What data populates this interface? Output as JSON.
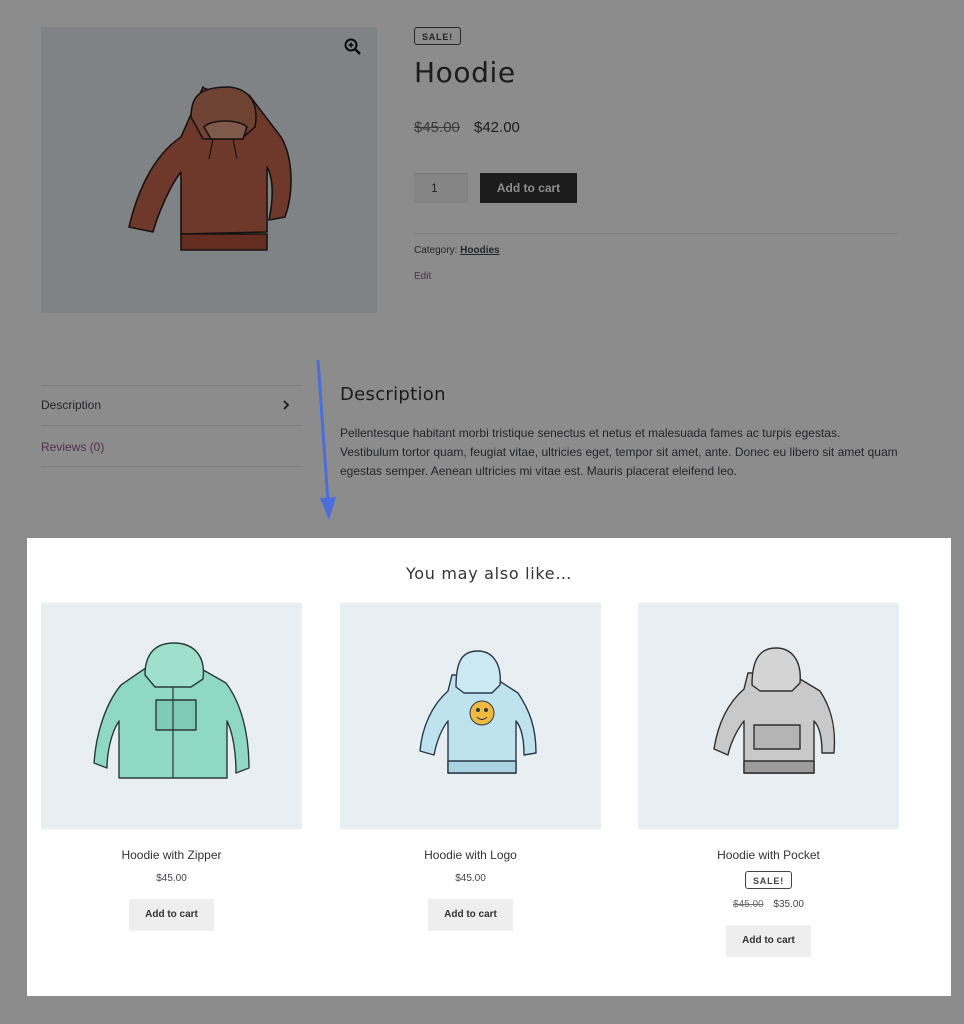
{
  "product": {
    "sale_badge": "SALE!",
    "title": "Hoodie",
    "old_price": "$45.00",
    "price": "$42.00",
    "quantity": "1",
    "add_to_cart": "Add to cart",
    "category_label": "Category:",
    "category_value": "Hoodies",
    "edit_link": "Edit",
    "image_icon": "hoodie-red-image",
    "zoom_icon": "zoom-in-icon"
  },
  "tabs": [
    {
      "label": "Description",
      "active": true
    },
    {
      "label": "Reviews (0)",
      "active": false
    }
  ],
  "description": {
    "heading": "Description",
    "text": "Pellentesque habitant morbi tristique senectus et netus et malesuada fames ac turpis egestas. Vestibulum tortor quam, feugiat vitae, ultricies eget, tempor sit amet, ante. Donec eu libero sit amet quam egestas semper. Aenean ultricies mi vitae est. Mauris placerat eleifend leo."
  },
  "related": {
    "title": "You may also like…",
    "products": [
      {
        "name": "Hoodie with Zipper",
        "price": "$45.00",
        "button": "Add to cart",
        "color": "#8fd8c4"
      },
      {
        "name": "Hoodie with Logo",
        "price": "$45.00",
        "button": "Add to cart",
        "color": "#bfe3ee"
      },
      {
        "name": "Hoodie with Pocket",
        "sale_badge": "SALE!",
        "old_price": "$45.00",
        "price": "$35.00",
        "button": "Add to cart",
        "color": "#c9c9c9"
      }
    ]
  },
  "colors": {
    "accent_purple": "#96588a",
    "dark_button": "#333333",
    "arrow_blue": "#4a6fdc",
    "hoodie_red": "#c8684f"
  }
}
